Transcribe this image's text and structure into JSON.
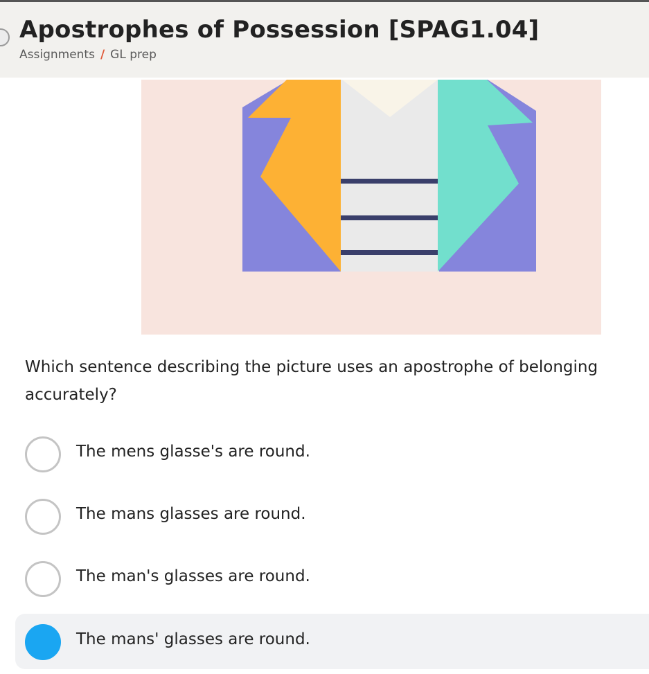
{
  "header": {
    "title": "Apostrophes of Possession [SPAG1.04]",
    "breadcrumb": [
      {
        "label": "Assignments"
      },
      {
        "label": "GL prep"
      }
    ],
    "separator": "/"
  },
  "picture": {
    "subject": "jacket-with-striped-shirt",
    "colors": {
      "background": "#f8e4de",
      "jacket": "#8585dc",
      "left_lapel": "#fdb134",
      "right_lapel": "#72dfcd",
      "shirt": "#eaeaea",
      "collar": "#f9f4e8",
      "stripes": "#3a3f6b"
    }
  },
  "question": {
    "text": "Which sentence describing the picture uses an apostrophe of belonging accurately?"
  },
  "options": [
    {
      "label": "The mens glasse's are round.",
      "selected": false
    },
    {
      "label": "The mans glasses are round.",
      "selected": false
    },
    {
      "label": "The man's glasses are round.",
      "selected": false
    },
    {
      "label": "The mans' glasses are round.",
      "selected": true
    }
  ],
  "colors": {
    "accent": "#1aa6f2",
    "breadcrumb_separator": "#e05a3a",
    "header_bg": "#f2f1ee",
    "selected_row_bg": "#f1f2f4"
  }
}
